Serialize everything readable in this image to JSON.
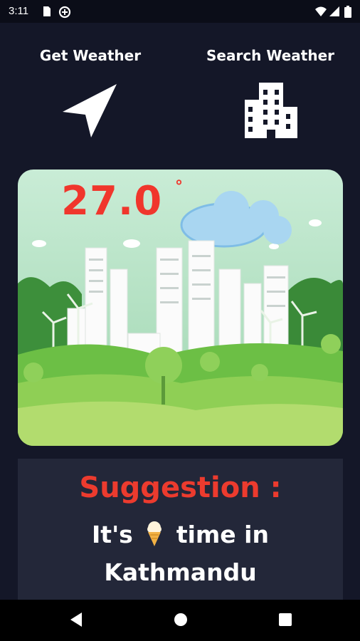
{
  "status_bar": {
    "time": "3:11",
    "icons": [
      "sim-card-icon",
      "data-saver-icon",
      "wifi-icon",
      "cell-signal-icon",
      "battery-icon"
    ]
  },
  "actions": {
    "get_weather_label": "Get Weather",
    "get_weather_icon": "navigation-arrow-icon",
    "search_weather_label": "Search Weather",
    "search_weather_icon": "city-building-icon"
  },
  "weather": {
    "temperature": "27.0",
    "degree_symbol": "°",
    "illustration": "green-city-illustration"
  },
  "suggestion": {
    "title": "Suggestion :",
    "text_before": "It's",
    "emoji_icon": "ice-cream-icon",
    "text_after": "time in",
    "city": "Kathmandu"
  },
  "colors": {
    "background": "#141728",
    "suggestion_box": "#232739",
    "accent_red": "#ec3b2e",
    "text": "#ffffff"
  },
  "nav_bar": {
    "buttons": [
      "back-icon",
      "home-icon",
      "recents-icon"
    ]
  }
}
